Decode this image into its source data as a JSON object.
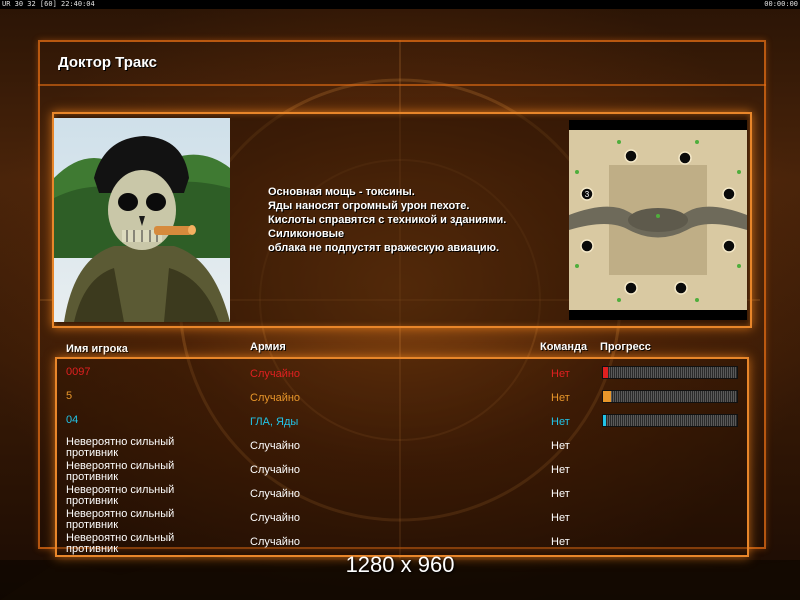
{
  "topbar": {
    "left_text": "UR 30 32 [60] 22:40:04",
    "right_text": "00:00:00"
  },
  "window": {
    "title": "Доктор Тракс"
  },
  "general": {
    "description_lines": [
      "Основная мощь - токсины.",
      "Яды наносят огромный урон пехоте.",
      "Кислоты справятся с техникой и зданиями.",
      "Силиконовые",
      "облака не подпустят вражескую авиацию."
    ]
  },
  "minimap": {
    "marker_label": "3"
  },
  "table": {
    "headers": {
      "player_name": "Имя игрока",
      "army": "Армия",
      "team": "Команда",
      "progress": "Прогресс"
    },
    "rows": [
      {
        "name": "0097",
        "army": "Случайно",
        "team": "Нет",
        "color": "#e02020",
        "progress": 0.04
      },
      {
        "name": "5",
        "army": "Случайно",
        "team": "Нет",
        "color": "#e8962a",
        "progress": 0.06
      },
      {
        "name": "04",
        "army": "ГЛА, Яды",
        "team": "Нет",
        "color": "#22c4e8",
        "progress": 0.01
      },
      {
        "name": "Невероятно сильный противник",
        "army": "Случайно",
        "team": "Нет",
        "color": "#ffffff"
      },
      {
        "name": "Невероятно сильный противник",
        "army": "Случайно",
        "team": "Нет",
        "color": "#ffffff"
      },
      {
        "name": "Невероятно сильный противник",
        "army": "Случайно",
        "team": "Нет",
        "color": "#ffffff"
      },
      {
        "name": "Невероятно сильный противник",
        "army": "Случайно",
        "team": "Нет",
        "color": "#ffffff"
      },
      {
        "name": "Невероятно сильный противник",
        "army": "Случайно",
        "team": "Нет",
        "color": "#ffffff"
      }
    ]
  },
  "resolution_label": "1280 x 960",
  "colors": {
    "accent_orange": "#e8862a"
  }
}
